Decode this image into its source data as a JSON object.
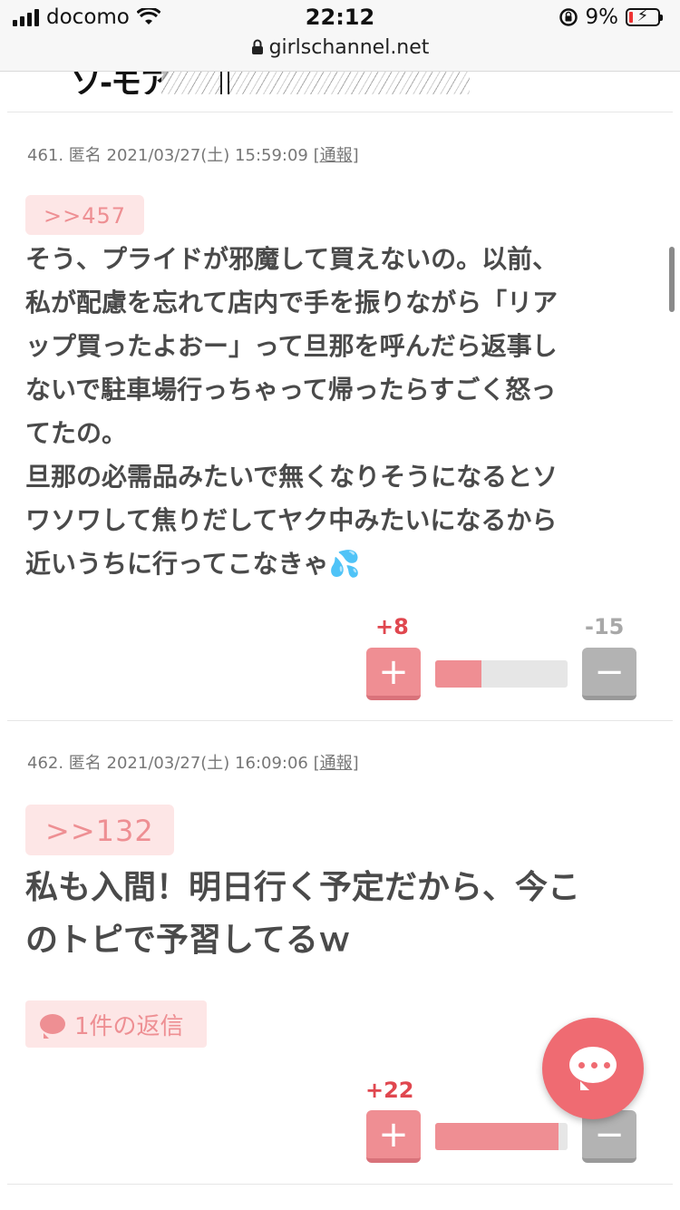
{
  "status_bar": {
    "carrier": "docomo",
    "time": "22:12",
    "url": "girlschannel.net",
    "battery": "9%"
  },
  "top_image": {
    "caption": "ソ-モア"
  },
  "comments": [
    {
      "meta_prefix": "461. 匿名 2021/03/27(土) 15:59:09 ",
      "report": "[通報]",
      "anchor": ">>457",
      "lines": [
        "そう、プライドが邪魔して買えないの。以前、",
        "私が配慮を忘れて店内で手を振りながら「リア",
        "ップ買ったよおー」って旦那を呼んだら返事し",
        "ないで駐車場行っちゃって帰ったらすごく怒っ",
        "てたの。",
        "旦那の必需品みたいで無くなりそうになるとソ",
        "ワソワして焦りだしてヤク中みたいになるから",
        "近いうちに行ってこなきゃ💦"
      ],
      "plus_count": "+8",
      "minus_count": "-15",
      "plus_label": "+",
      "minus_label": "−",
      "plus_ratio": 0.35
    },
    {
      "meta_prefix": "462. 匿名 2021/03/27(土) 16:09:06 ",
      "report": "[通報]",
      "anchor": ">>132",
      "lines": [
        "私も入間！明日行く予定だから、今こ",
        "のトピで予習してるｗ"
      ],
      "reply_label": "1件の返信",
      "plus_count": "+22",
      "plus_label": "+",
      "minus_label": "−",
      "plus_ratio": 0.93
    }
  ],
  "colors": {
    "accent": "#ef8e93",
    "plus_text": "#e0474f",
    "fab": "#ef6b72"
  },
  "icons": [
    "signal-icon",
    "wifi-icon",
    "lock-icon",
    "rotation-lock-icon",
    "battery-icon",
    "comment-icon",
    "chat-fab-icon"
  ]
}
